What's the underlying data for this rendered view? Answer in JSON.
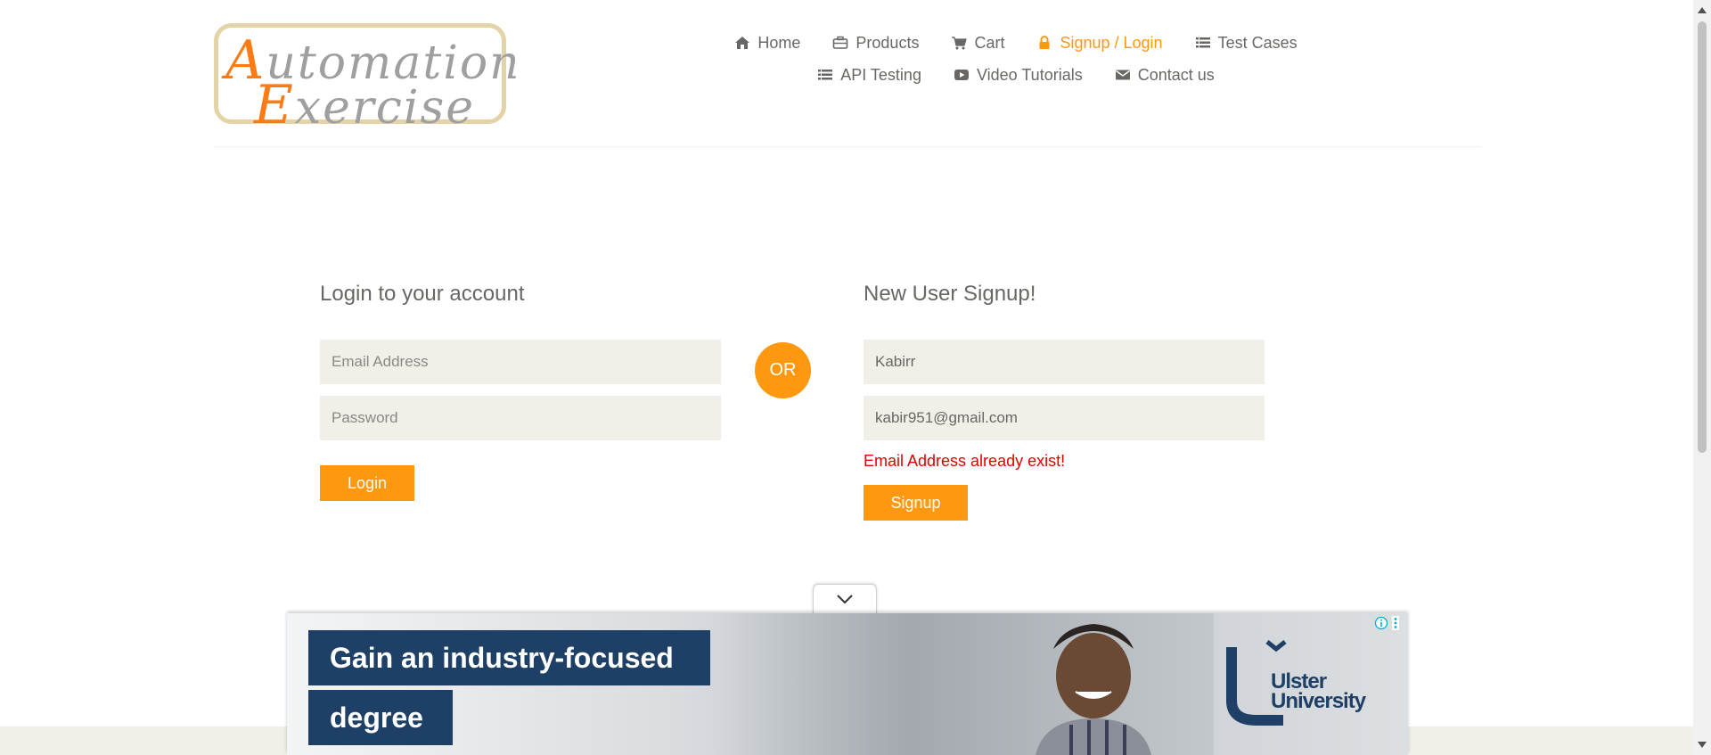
{
  "logo": {
    "line1_cap": "A",
    "line1_rest": "utomation",
    "line2_cap": "E",
    "line2_rest": "xercise"
  },
  "nav": {
    "items": [
      {
        "label": "Home",
        "icon": "home-icon"
      },
      {
        "label": "Products",
        "icon": "briefcase-icon"
      },
      {
        "label": "Cart",
        "icon": "cart-icon"
      },
      {
        "label": "Signup / Login",
        "icon": "lock-icon",
        "active": true
      },
      {
        "label": "Test Cases",
        "icon": "list-icon"
      },
      {
        "label": "API Testing",
        "icon": "list-icon"
      },
      {
        "label": "Video Tutorials",
        "icon": "youtube-play-icon"
      },
      {
        "label": "Contact us",
        "icon": "envelope-icon"
      }
    ]
  },
  "login": {
    "title": "Login to your account",
    "email_placeholder": "Email Address",
    "password_placeholder": "Password",
    "button": "Login"
  },
  "or_label": "OR",
  "signup": {
    "title": "New User Signup!",
    "name_value": "Kabirr",
    "email_value": "kabir951@gmail.com",
    "error": "Email Address already exist!",
    "button": "Signup"
  },
  "ad": {
    "headline_line1": "Gain an industry-focused",
    "headline_line2": "degree",
    "brand_line1": "Ulster",
    "brand_line2": "University"
  },
  "colors": {
    "accent": "#fe980f",
    "text": "#696763",
    "input_bg": "#f0f0e9",
    "error": "#e10000",
    "ad_blue": "#1e3f66"
  }
}
